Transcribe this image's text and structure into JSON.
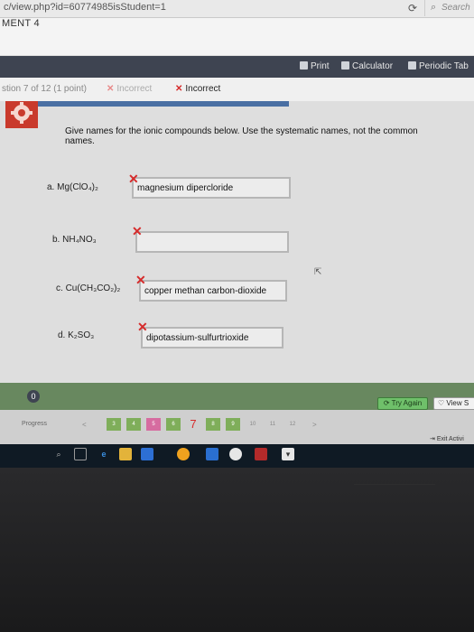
{
  "browser": {
    "url": "c/view.php?id=60774985isStudent=1",
    "search_placeholder": "Search",
    "reload_glyph": "⟳",
    "search_icon": "magnifier"
  },
  "assignment": {
    "title": "MENT 4"
  },
  "toolbar": {
    "print": "Print",
    "calculator": "Calculator",
    "periodic": "Periodic Tab"
  },
  "question_status": {
    "label": "stion 7 of 12 (1 point)",
    "attempts": [
      "Incorrect",
      "Incorrect"
    ]
  },
  "content": {
    "instructions": "Give names for the ionic compounds below. Use the systematic names, not the common names.",
    "questions": [
      {
        "letter": "a.",
        "formula_html": "Mg(ClO₄)₂",
        "answer": "magnesium dipercloride"
      },
      {
        "letter": "b.",
        "formula_html": "NH₄NO₃",
        "answer": ""
      },
      {
        "letter": "c.",
        "formula_html": "Cu(CH₃CO₂)₂",
        "answer": "copper methan carbon-dioxide"
      },
      {
        "letter": "d.",
        "formula_html": "K₂SO₃",
        "answer": "dipotassium-sulfurtrioxide"
      }
    ]
  },
  "actions": {
    "try_again": "Try Again",
    "view_solution": "View S",
    "info": "0"
  },
  "progress": {
    "label": "Progress",
    "prev": "<",
    "next": ">",
    "current": 7,
    "pages": [
      {
        "label": "3",
        "color": "#7fae5a"
      },
      {
        "label": "4",
        "color": "#7fae5a"
      },
      {
        "label": "5",
        "color": "#d66ca0"
      },
      {
        "label": "6",
        "color": "#7fae5a"
      },
      {
        "label": "7",
        "color": "#d66ca0"
      },
      {
        "label": "8",
        "color": "#7fae5a"
      },
      {
        "label": "9",
        "color": "#7fae5a"
      },
      {
        "label": "10",
        "color": "#cfcfcf"
      },
      {
        "label": "11",
        "color": "#cfcfcf"
      },
      {
        "label": "12",
        "color": "#cfcfcf"
      }
    ],
    "exit_label": "Exit Activi"
  },
  "colors": {
    "toolbar_bg": "#3e4451",
    "action_bar_bg": "#68885f",
    "incorrect_red": "#d62b2b"
  }
}
